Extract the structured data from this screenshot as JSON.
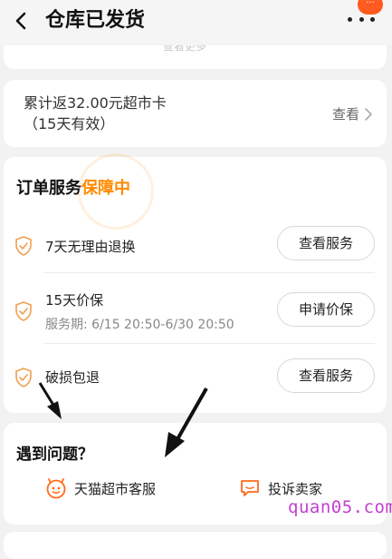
{
  "header": {
    "title": "仓库已发货",
    "badge": "···"
  },
  "prev_card": {
    "partial_text": "查看更多"
  },
  "rebate": {
    "text_line1": "累计返32.00元超市卡",
    "text_line2": "（15天有效）",
    "link": "查看"
  },
  "order_service": {
    "title": "订单服务",
    "title_accent": "保障中",
    "accent_color": "#ff8a00",
    "items": [
      {
        "name": "7天无理由退换",
        "sub": "",
        "button": "查看服务"
      },
      {
        "name": "15天价保",
        "sub": "服务期: 6/15 20:50-6/30 20:50",
        "button": "申请价保"
      },
      {
        "name": "破损包退",
        "sub": "",
        "button": "查看服务"
      }
    ]
  },
  "problem": {
    "title": "遇到问题？",
    "contacts": [
      {
        "label": "天猫超市客服",
        "icon": "service-face-icon"
      },
      {
        "label": "投诉卖家",
        "icon": "complaint-chat-icon"
      }
    ]
  },
  "watermark": "quan05.com"
}
